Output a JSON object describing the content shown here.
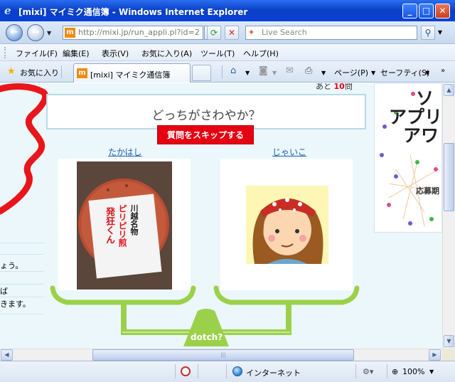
{
  "window": {
    "title": "[mixi] マイミク通信簿 - Windows Internet Explorer",
    "logo": "e",
    "buttons": {
      "minimize": "_",
      "maximize": "□",
      "close": "✕"
    }
  },
  "address_bar": {
    "url": "http://mixi.jp/run_appli.pl?id=2",
    "favicon": "m",
    "search_placeholder": "Live Search",
    "search_logo": "✦"
  },
  "menu": [
    "ファイル(F)",
    "編集(E)",
    "表示(V)",
    "お気に入り(A)",
    "ツール(T)",
    "ヘルプ(H)"
  ],
  "tabs": {
    "favorites_label": "お気に入り",
    "active_tab": "[mixi] マイミク通信簿"
  },
  "command_bar": {
    "page": "ページ(P)",
    "safety": "セーフティ(S)"
  },
  "page": {
    "question": "どっちがさわやか？",
    "skip_button": "質問をスキップする",
    "choice_left": "たかはし",
    "choice_right": "じゃいこ",
    "scale_label": "dotch?",
    "top_partial": "あと",
    "top_partial_num": "10",
    "top_partial_suffix": "問",
    "left_text_1": "ょう。",
    "left_text_2": "ば",
    "left_text_3": "きます。",
    "photo_label_line1": "川越名物",
    "photo_label_line2": "ピリピリ煎",
    "photo_label_line3": "発狂くん",
    "right_panel": {
      "line1": "ソ",
      "line2": "アプリ",
      "line3": "アワ",
      "small": "応募期"
    }
  },
  "status_bar": {
    "zone": "インターネット",
    "zoom": "100%"
  },
  "colors": {
    "accent_red": "#e60012",
    "scale_green": "#9bd14a",
    "link_blue": "#1d5fb2"
  }
}
